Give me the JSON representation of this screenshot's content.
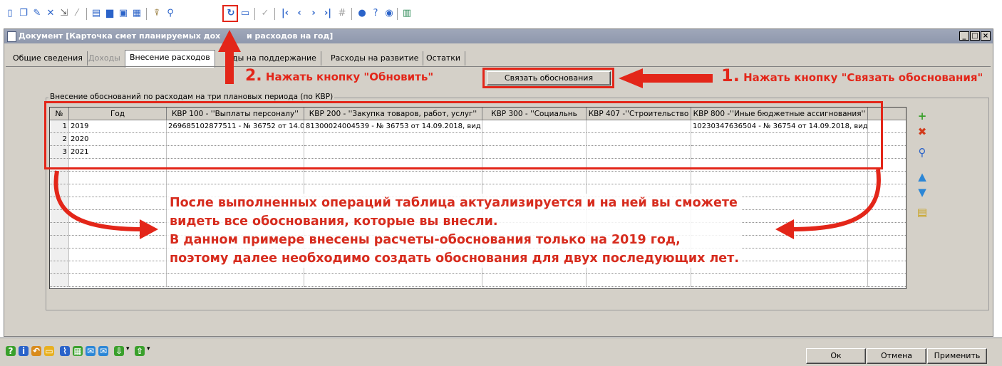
{
  "toolbar": {
    "icons": [
      "new-doc-icon",
      "copy-doc-icon",
      "edit-doc-icon",
      "delete-doc-icon",
      "export-icon",
      "wand-icon",
      "preview-icon",
      "print-icon",
      "print-preview-icon",
      "print-setup-icon",
      "filter-icon",
      "find-icon",
      "refresh-icon",
      "save-icon",
      "check-icon",
      "first-icon",
      "prev-icon",
      "next-icon",
      "last-icon",
      "goto-icon",
      "info-icon",
      "help-icon",
      "mail-icon",
      "calc-icon"
    ]
  },
  "window": {
    "title": "Документ [Карточка смет планируемых доходов и расходов на год]",
    "title_visible_left": "Документ [Карточка смет планируемых дох",
    "title_visible_right": "и расходов на год]",
    "min_glyph": "_",
    "max_glyph": "□",
    "close_glyph": "×"
  },
  "tabs": [
    {
      "label": "Общие сведения",
      "state": "normal"
    },
    {
      "label": "Доходы",
      "state": "disabled"
    },
    {
      "label": "Внесение расходов",
      "state": "active"
    },
    {
      "label": "Расходы на поддержание",
      "state": "normal"
    },
    {
      "label": "Расходы  на развитие",
      "state": "normal"
    },
    {
      "label": "Остатки",
      "state": "normal"
    }
  ],
  "tab_partial": "ды на поддержание",
  "link_button": {
    "label": "Связать обоснования"
  },
  "group_title": "Внесение обоснований по расходам на три плановых периода (по КВР)",
  "grid": {
    "columns": [
      "№",
      "Год",
      "КВР 100 - ''Выплаты персоналу''",
      "КВР 200 - ''Закупка товаров, работ, услуг''",
      "КВР 300 - ''Социальнь",
      "КВР 407 -''Строительство",
      "КВР 800 -''Иные бюджетные ассигнования''"
    ],
    "rows": [
      {
        "num": "1",
        "year": "2019",
        "kvr100": "269685102877511 - № 36752 от 14.0",
        "kvr200": "81300024004539 - № 36753 от 14.09.2018, вид",
        "kvr300": "",
        "kvr407": "",
        "kvr800": "10230347636504 - № 36754 от 14.09.2018, вид"
      },
      {
        "num": "2",
        "year": "2020",
        "kvr100": "",
        "kvr200": "",
        "kvr300": "",
        "kvr407": "",
        "kvr800": ""
      },
      {
        "num": "3",
        "year": "2021",
        "kvr100": "",
        "kvr200": "",
        "kvr300": "",
        "kvr407": "",
        "kvr800": ""
      }
    ]
  },
  "side_tools": [
    "add-icon",
    "delete-icon",
    "search-icon",
    "move-up-icon",
    "move-down-icon",
    "table-settings-icon"
  ],
  "annotations": {
    "step1_num": "1.",
    "step1_text": "Нажать кнопку \"Связать обоснования\"",
    "step2_num": "2.",
    "step2_text": "Нажать кнопку \"Обновить\"",
    "overlay": [
      "После выполненных операций таблица актуализируется и на ней вы сможете",
      "видеть все обоснования, которые вы внесли.",
      "В данном примере внесены расчеты-обоснования только на 2019 год,",
      "поэтому далее необходимо создать обоснования для двух последующих лет."
    ],
    "accent_color": "#e32619"
  },
  "footer": {
    "ok": "Ок",
    "cancel": "Отмена",
    "apply": "Применить"
  }
}
